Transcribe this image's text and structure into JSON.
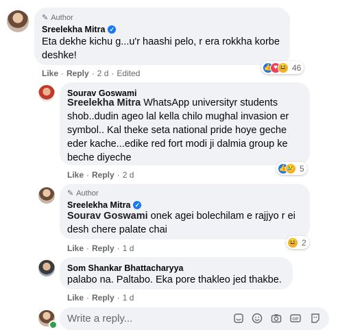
{
  "comment1": {
    "author_badge": "Author",
    "name": "Sreelekha Mitra",
    "text": "Eta dekhe kichu g...u'r haashi pelo, r era rokkha korbe deshke!",
    "like": "Like",
    "reply": "Reply",
    "time": "2 d",
    "edited": "Edited",
    "reaction_count": "46"
  },
  "reply1": {
    "name": "Sourav Goswami",
    "tag": "Sreelekha Mitra",
    "text": " WhatsApp universityr students shob..dudin ageo lal kella chilo mughal invasion er symbol.. Kal theke seta national pride hoye geche eder kache...edike red fort modi ji dalmia group ke beche diyeche",
    "like": "Like",
    "reply": "Reply",
    "time": "2 d",
    "reaction_count": "5"
  },
  "reply2": {
    "author_badge": "Author",
    "name": "Sreelekha Mitra",
    "tag": "Sourav Goswami",
    "text": " onek agei bolechilam e rajjyo r ei desh chere palate chai",
    "like": "Like",
    "reply": "Reply",
    "time": "1 d",
    "reaction_count": "2"
  },
  "reply3": {
    "name": "Som Shankar Bhattacharyya",
    "text": "palabo na. Paltabo. Eka pore thakleo jed thakbe.",
    "like": "Like",
    "reply": "Reply",
    "time": "1 d"
  },
  "composer": {
    "placeholder": "Write a reply...",
    "icons": [
      "sticker-icon",
      "emoji-icon",
      "camera-icon",
      "gif-icon",
      "avatar-sticker-icon"
    ]
  },
  "colors": {
    "bubble": "#f0f2f5",
    "secondary_text": "#65676b",
    "accent": "#1877f2"
  }
}
